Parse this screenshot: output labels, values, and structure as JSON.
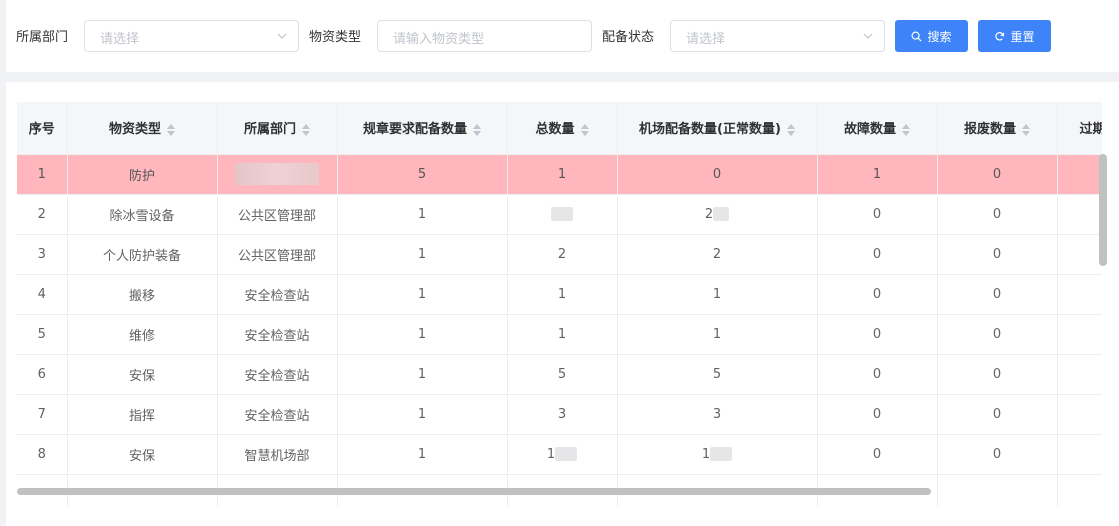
{
  "filters": {
    "dept_label": "所属部门",
    "dept_placeholder": "请选择",
    "type_label": "物资类型",
    "type_placeholder": "请输入物资类型",
    "status_label": "配备状态",
    "status_placeholder": "请选择",
    "search_label": "搜索",
    "reset_label": "重置"
  },
  "colors": {
    "primary": "#3f83f8",
    "highlight_row": "#ffb7bd"
  },
  "table": {
    "headers": [
      "序号",
      "物资类型",
      "所属部门",
      "规章要求配备数量",
      "总数量",
      "机场配备数量(正常数量)",
      "故障数量",
      "报废数量",
      "过期"
    ],
    "rows": [
      [
        "1",
        "防护",
        "",
        "5",
        "1",
        "0",
        "1",
        "0",
        ""
      ],
      [
        "2",
        "除冰雪设备",
        "公共区管理部",
        "1",
        "",
        "2",
        "0",
        "0",
        ""
      ],
      [
        "3",
        "个人防护装备",
        "公共区管理部",
        "1",
        "2",
        "2",
        "0",
        "0",
        ""
      ],
      [
        "4",
        "搬移",
        "安全检查站",
        "1",
        "1",
        "1",
        "0",
        "0",
        ""
      ],
      [
        "5",
        "维修",
        "安全检查站",
        "1",
        "1",
        "1",
        "0",
        "0",
        ""
      ],
      [
        "6",
        "安保",
        "安全检查站",
        "1",
        "5",
        "5",
        "0",
        "0",
        ""
      ],
      [
        "7",
        "指挥",
        "安全检查站",
        "1",
        "3",
        "3",
        "0",
        "0",
        ""
      ],
      [
        "8",
        "安保",
        "智慧机场部",
        "1",
        "1",
        "1",
        "0",
        "0",
        ""
      ]
    ]
  }
}
